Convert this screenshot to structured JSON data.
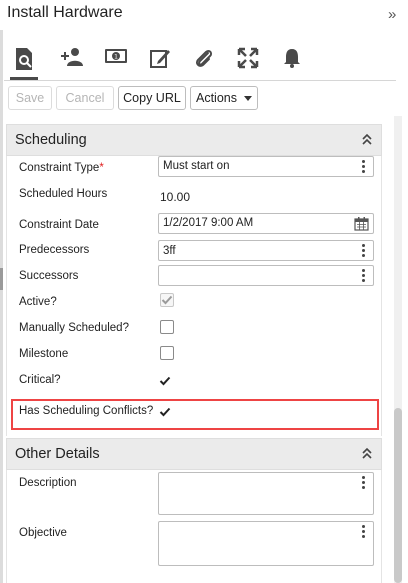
{
  "header": {
    "title": "Install Hardware",
    "collapse_glyph": "»"
  },
  "tabs": [
    {
      "icon": "document-search-icon",
      "active": true
    },
    {
      "icon": "add-person-icon",
      "active": false
    },
    {
      "icon": "money-icon",
      "active": false
    },
    {
      "icon": "edit-icon",
      "active": false
    },
    {
      "icon": "paperclip-icon",
      "active": false
    },
    {
      "icon": "expand-icon",
      "active": false
    },
    {
      "icon": "bell-icon",
      "active": false
    }
  ],
  "toolbar": {
    "save_label": "Save",
    "cancel_label": "Cancel",
    "copy_url_label": "Copy URL",
    "actions_label": "Actions"
  },
  "scheduling": {
    "title": "Scheduling",
    "constraint_type": {
      "label": "Constraint Type",
      "required_mark": "*",
      "value": "Must start on"
    },
    "scheduled_hours": {
      "label": "Scheduled Hours",
      "value": "10.00"
    },
    "constraint_date": {
      "label": "Constraint Date",
      "value": "1/2/2017 9:00 AM"
    },
    "predecessors": {
      "label": "Predecessors",
      "value": "3ff"
    },
    "successors": {
      "label": "Successors",
      "value": ""
    },
    "active": {
      "label": "Active?",
      "checked": true,
      "disabled": true
    },
    "manually_scheduled": {
      "label": "Manually Scheduled?",
      "checked": false
    },
    "milestone": {
      "label": "Milestone",
      "checked": false
    },
    "critical": {
      "label": "Critical?",
      "checked": true
    },
    "has_conflicts": {
      "label": "Has Scheduling Conflicts?",
      "checked": true
    }
  },
  "other_details": {
    "title": "Other Details",
    "description": {
      "label": "Description",
      "value": ""
    },
    "objective": {
      "label": "Objective",
      "value": ""
    }
  },
  "colors": {
    "highlight": "#ee4444",
    "required": "#e02020",
    "section_header_bg": "#ebebeb"
  }
}
